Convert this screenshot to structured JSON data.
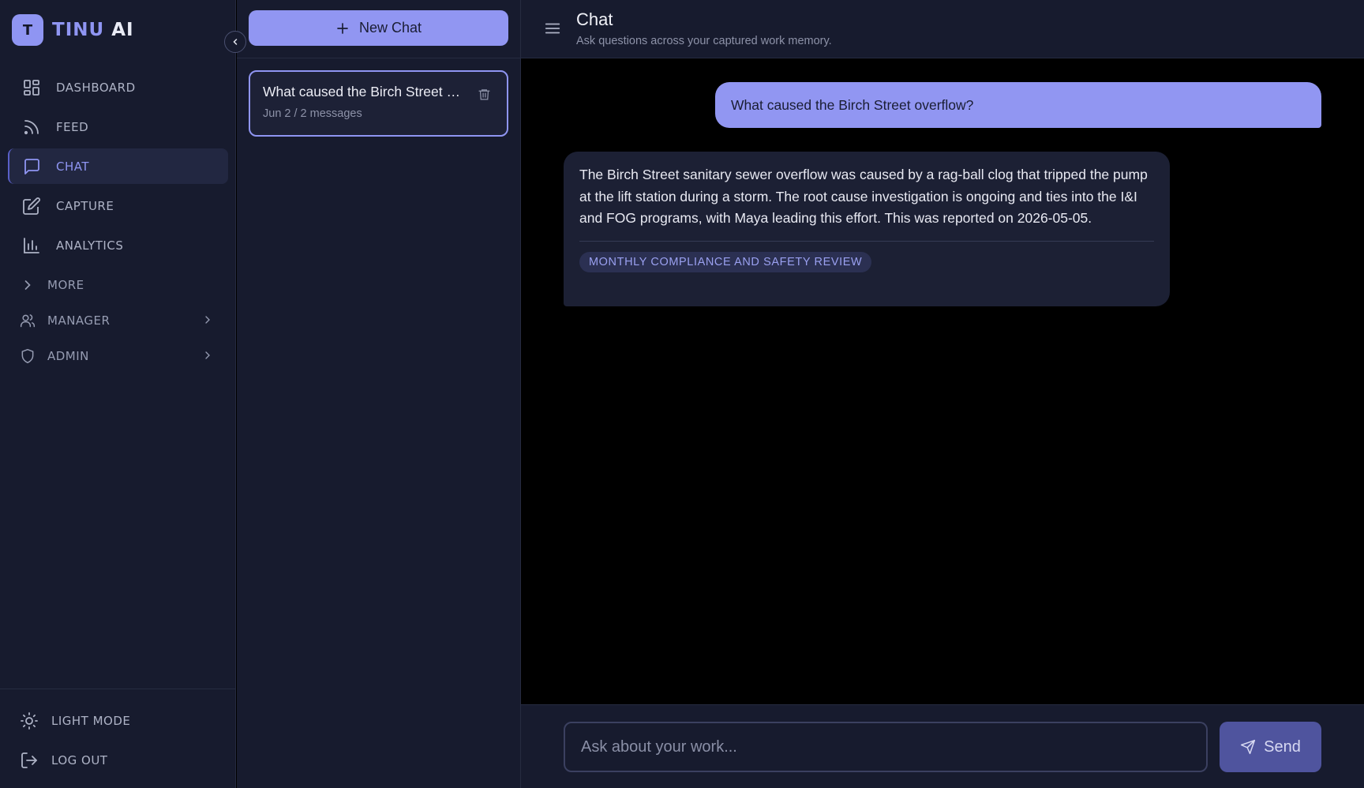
{
  "brand": {
    "logo_letter": "T",
    "name_part1": "TINU",
    "name_part2": "AI"
  },
  "sidebar": {
    "nav_items": [
      {
        "label": "DASHBOARD",
        "icon": "dashboard-grid-icon"
      },
      {
        "label": "FEED",
        "icon": "rss-feed-icon"
      },
      {
        "label": "CHAT",
        "icon": "chat-bubble-icon",
        "active": true
      },
      {
        "label": "CAPTURE",
        "icon": "edit-pencil-icon"
      },
      {
        "label": "ANALYTICS",
        "icon": "bar-chart-icon"
      }
    ],
    "more_label": "MORE",
    "manager_label": "MANAGER",
    "admin_label": "ADMIN",
    "light_mode_label": "LIGHT MODE",
    "logout_label": "LOG OUT"
  },
  "conversations": {
    "new_chat_label": "New Chat",
    "items": [
      {
        "title": "What caused the Birch Street overflow?",
        "meta": "Jun 2 / 2 messages",
        "selected": true
      }
    ]
  },
  "main": {
    "title": "Chat",
    "subtitle": "Ask questions across your captured work memory.",
    "messages": {
      "user": "What caused the Birch Street overflow?",
      "assistant": "The Birch Street sanitary sewer overflow was caused by a rag-ball clog that tripped the pump at the lift station during a storm. The root cause investigation is ongoing and ties into the I&I and FOG programs, with Maya leading this effort. This was reported on 2026-05-05.",
      "source": "MONTHLY COMPLIANCE AND SAFETY REVIEW"
    },
    "composer": {
      "placeholder": "Ask about your work...",
      "send_label": "Send"
    }
  },
  "colors": {
    "accent": "#8f95f2",
    "sidebar_bg": "#171b2e",
    "main_bg": "#000000",
    "bot_bubble": "#1c2034"
  }
}
